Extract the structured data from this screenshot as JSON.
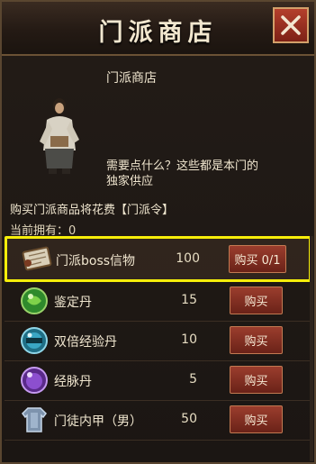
{
  "header": {
    "title": "门派商店"
  },
  "shop": {
    "name": "门派商店",
    "npc_dialog": "需要点什么？这些都是本门的独家供应",
    "cost_text": "购买门派商品将花费【门派令】",
    "owned_text": "当前拥有：0"
  },
  "items": [
    {
      "name": "门派boss信物",
      "price": "100",
      "buy_label": "购买 0/1",
      "icon": "scroll-icon"
    },
    {
      "name": "鉴定丹",
      "price": "15",
      "buy_label": "购买",
      "icon": "green-orb-icon"
    },
    {
      "name": "双倍经验丹",
      "price": "10",
      "buy_label": "购买",
      "icon": "exp-orb-icon"
    },
    {
      "name": "经脉丹",
      "price": "5",
      "buy_label": "购买",
      "icon": "purple-orb-icon"
    },
    {
      "name": "门徒内甲（男）",
      "price": "50",
      "buy_label": "购买",
      "icon": "armor-icon"
    }
  ]
}
